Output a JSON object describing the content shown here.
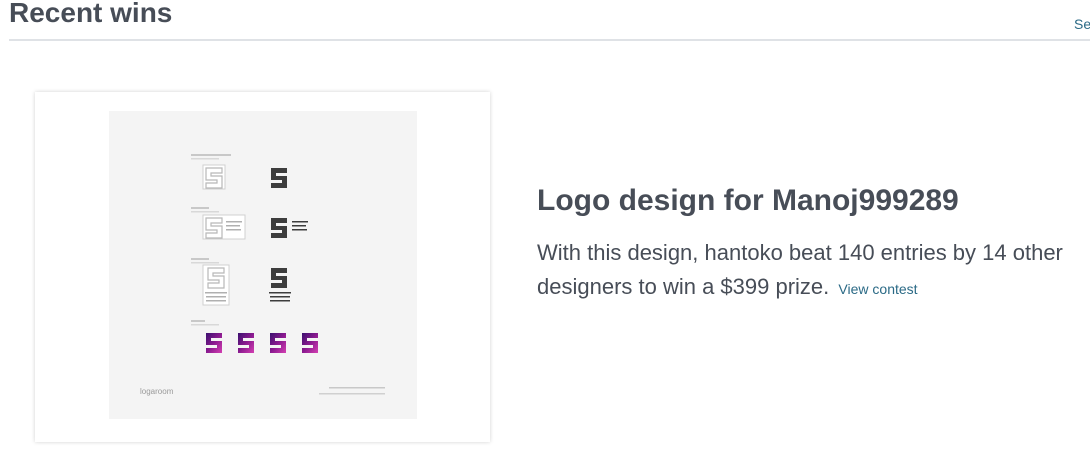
{
  "header": {
    "title": "Recent wins",
    "see_all_label": "See all"
  },
  "win": {
    "title": "Logo design for Manoj999289",
    "description_part1": "With this design, hantoko beat 140 entries by 14 other",
    "description_part2": "designers to win a $399 prize.",
    "view_link": "View contest"
  },
  "thumbnail": {
    "brand": "logaroom",
    "accent_color": "#7a1f8c",
    "background_color": "#f4f4f4"
  }
}
